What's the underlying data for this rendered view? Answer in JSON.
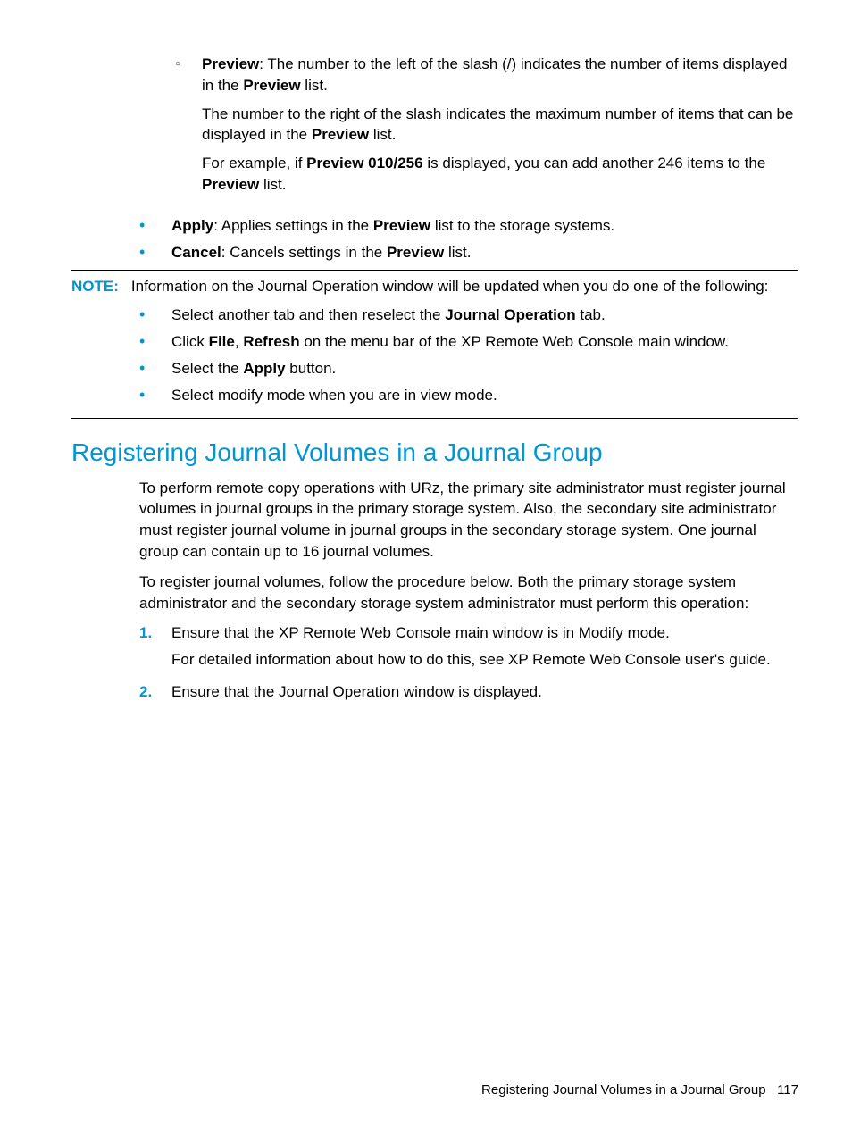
{
  "sub": {
    "label": "Preview",
    "p1a": ": The number to the left of the slash (/) indicates the number of items displayed in the ",
    "p1b": "Preview",
    "p1c": " list.",
    "p2a": "The number to the right of the slash indicates the maximum number of items that can be displayed in the ",
    "p2b": "Preview",
    "p2c": " list.",
    "p3a": "For example, if ",
    "p3b": "Preview 010/256",
    "p3c": " is displayed, you can add another 246 items to the ",
    "p3d": "Preview",
    "p3e": " list."
  },
  "b1": {
    "label": "Apply",
    "t1": ": Applies settings in the ",
    "t2": "Preview",
    "t3": " list to the storage systems."
  },
  "b2": {
    "label": "Cancel",
    "t1": ": Cancels settings in the ",
    "t2": "Preview",
    "t3": " list."
  },
  "note": {
    "label": "NOTE:",
    "intro": "Information on the Journal Operation window will be updated when you do one of the following:",
    "i1a": "Select another tab and then reselect the ",
    "i1b": "Journal Operation",
    "i1c": " tab.",
    "i2a": "Click ",
    "i2b": "File",
    "i2c": ", ",
    "i2d": "Refresh",
    "i2e": " on the menu bar of the XP Remote Web Console main window.",
    "i3a": "Select the ",
    "i3b": "Apply",
    "i3c": " button.",
    "i4": "Select modify mode when you are in view mode."
  },
  "heading": "Registering Journal Volumes in a Journal Group",
  "p1": "To perform remote copy operations with URz, the primary site administrator must register journal volumes in journal groups in the primary storage system. Also, the secondary site administrator must register journal volume in journal groups in the secondary storage system. One journal group can contain up to 16 journal volumes.",
  "p2": "To register journal volumes, follow the procedure below. Both the primary storage system administrator and the secondary storage system administrator must perform this operation:",
  "ol": {
    "n1": "1.",
    "t1a": "Ensure that the XP Remote Web Console main window is in Modify mode.",
    "t1b": "For detailed information about how to do this, see XP Remote Web Console user's guide.",
    "n2": "2.",
    "t2": "Ensure that the Journal Operation window is displayed."
  },
  "footer": {
    "title": "Registering Journal Volumes in a Journal Group",
    "page": "117"
  }
}
